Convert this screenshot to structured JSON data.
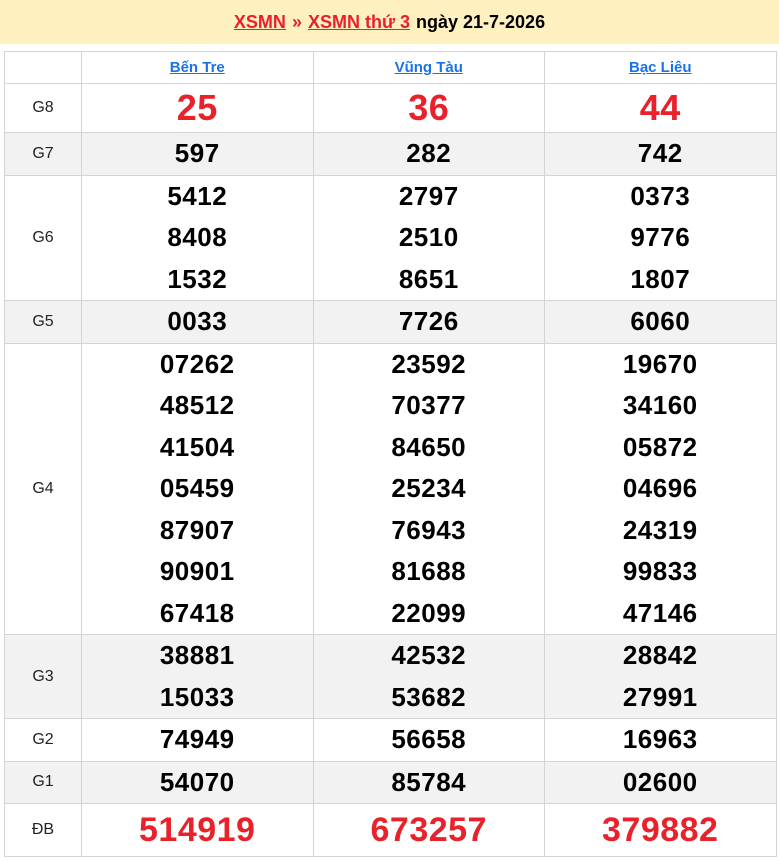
{
  "header": {
    "link1": "XSMN",
    "separator": "»",
    "link2": "XSMN thứ 3",
    "date_text": "ngày 21-7-2026"
  },
  "provinces": [
    "Bến Tre",
    "Vũng Tàu",
    "Bạc Liêu"
  ],
  "prizes": [
    {
      "label": "G8",
      "values": [
        [
          "25"
        ],
        [
          "36"
        ],
        [
          "44"
        ]
      ]
    },
    {
      "label": "G7",
      "values": [
        [
          "597"
        ],
        [
          "282"
        ],
        [
          "742"
        ]
      ]
    },
    {
      "label": "G6",
      "values": [
        [
          "5412",
          "8408",
          "1532"
        ],
        [
          "2797",
          "2510",
          "8651"
        ],
        [
          "0373",
          "9776",
          "1807"
        ]
      ]
    },
    {
      "label": "G5",
      "values": [
        [
          "0033"
        ],
        [
          "7726"
        ],
        [
          "6060"
        ]
      ]
    },
    {
      "label": "G4",
      "values": [
        [
          "07262",
          "48512",
          "41504",
          "05459",
          "87907",
          "90901",
          "67418"
        ],
        [
          "23592",
          "70377",
          "84650",
          "25234",
          "76943",
          "81688",
          "22099"
        ],
        [
          "19670",
          "34160",
          "05872",
          "04696",
          "24319",
          "99833",
          "47146"
        ]
      ]
    },
    {
      "label": "G3",
      "values": [
        [
          "38881",
          "15033"
        ],
        [
          "42532",
          "53682"
        ],
        [
          "28842",
          "27991"
        ]
      ]
    },
    {
      "label": "G2",
      "values": [
        [
          "74949"
        ],
        [
          "56658"
        ],
        [
          "16963"
        ]
      ]
    },
    {
      "label": "G1",
      "values": [
        [
          "54070"
        ],
        [
          "85784"
        ],
        [
          "02600"
        ]
      ]
    },
    {
      "label": "ĐB",
      "values": [
        [
          "514919"
        ],
        [
          "673257"
        ],
        [
          "379882"
        ]
      ]
    }
  ],
  "colors": {
    "accent_red": "#e8212a",
    "link_blue": "#1a73e8",
    "header_bg": "#fff0c0",
    "alt_row_bg": "#f2f2f2"
  }
}
